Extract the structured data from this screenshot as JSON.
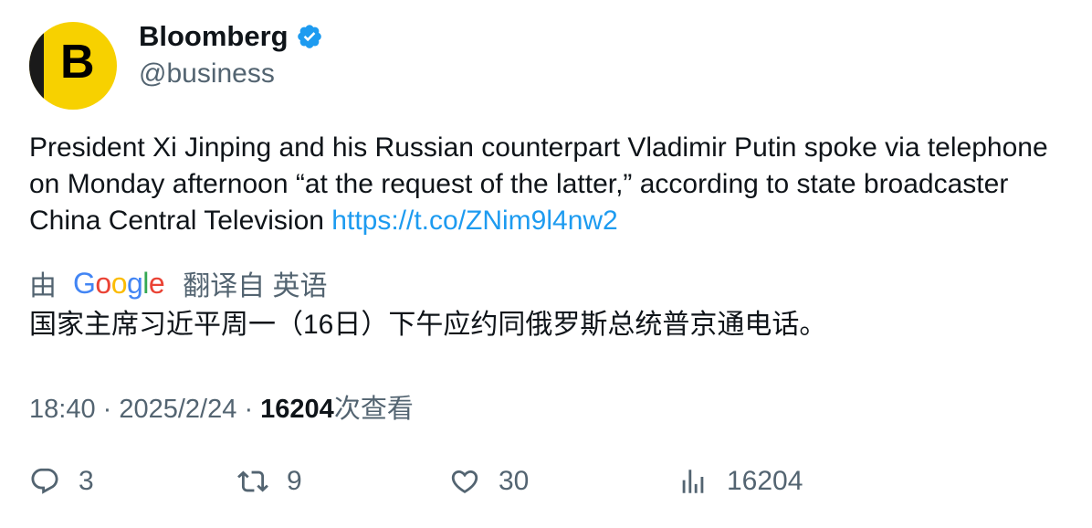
{
  "author": {
    "avatar_letter": "B",
    "name": "Bloomberg",
    "handle": "@business",
    "verified": true
  },
  "tweet": {
    "text": "President Xi Jinping and his Russian counterpart Vladimir Putin spoke via telephone on Monday afternoon “at the request of the latter,” according to state broadcaster China Central Television ",
    "link": "https://t.co/ZNim9l4nw2"
  },
  "translation": {
    "prefix": "由",
    "provider_logo": "Google",
    "suffix": "翻译自 英语",
    "text": "国家主席习近平周一（16日）下午应约同俄罗斯总统普京通电话。"
  },
  "meta": {
    "time": "18:40",
    "date": "2025/2/24",
    "views": "16204",
    "views_label": "次查看"
  },
  "actions": {
    "replies": "3",
    "retweets": "9",
    "likes": "30",
    "views": "16204"
  },
  "colors": {
    "link": "#1d9bf0",
    "secondary_text": "#536471",
    "avatar_bg": "#f7d100"
  }
}
